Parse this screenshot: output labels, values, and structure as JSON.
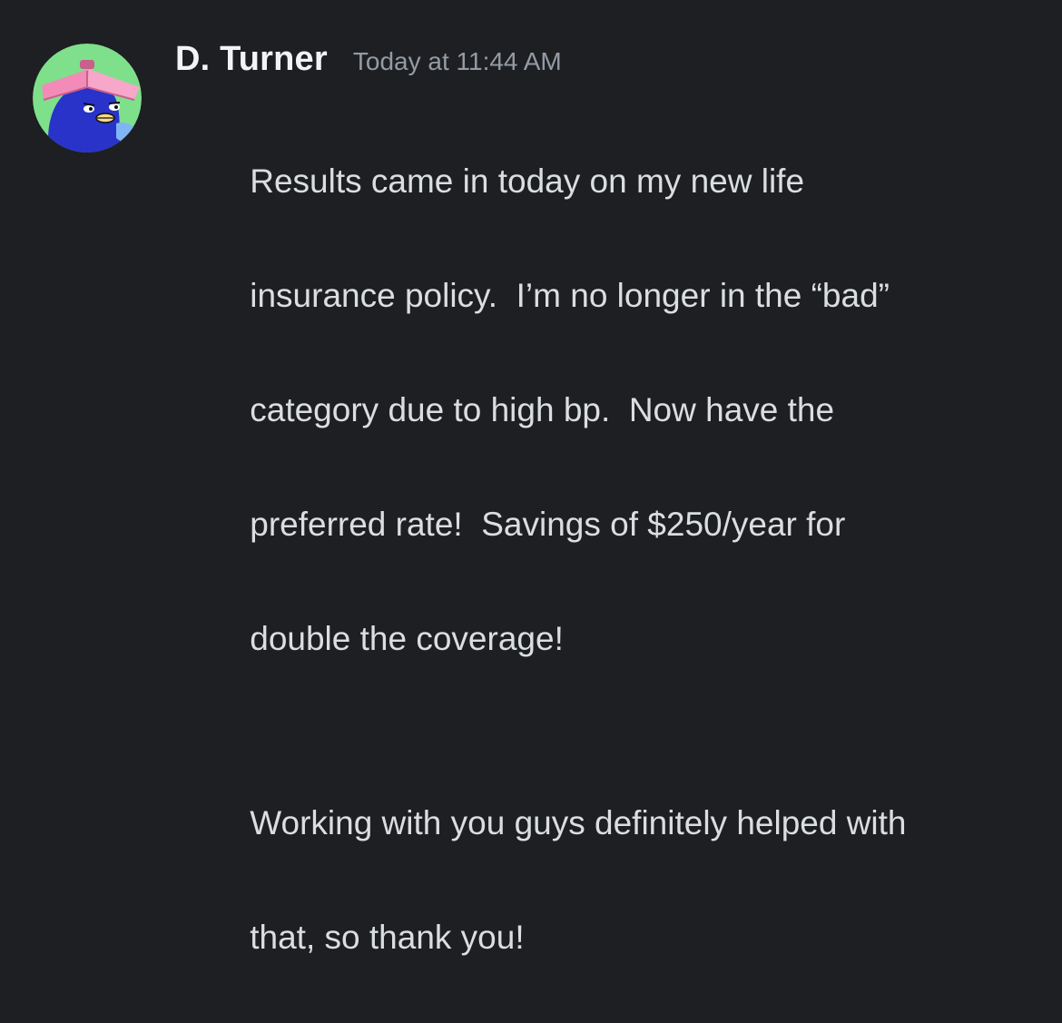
{
  "message": {
    "author": "D. Turner",
    "timestamp": "Today at 11:44 AM",
    "paragraphs": [
      {
        "lines": [
          "Results came in today on my new life",
          "insurance policy.  I’m no longer in the “bad”",
          "category due to high bp.  Now have the",
          "preferred rate!  Savings of $250/year for",
          "double the coverage!"
        ]
      },
      {
        "lines": [
          "Working with you guys definitely helped with",
          "that, so thank you!"
        ]
      }
    ]
  },
  "avatar": {
    "icon": "bird-with-book-avatar",
    "background_color": "#7ee08a",
    "body_color": "#2a33c9",
    "book_color": "#f28bb8"
  },
  "colors": {
    "background": "#1e1f22",
    "username": "#f2f3f5",
    "timestamp": "#949ba4",
    "text": "#dbdee1"
  }
}
